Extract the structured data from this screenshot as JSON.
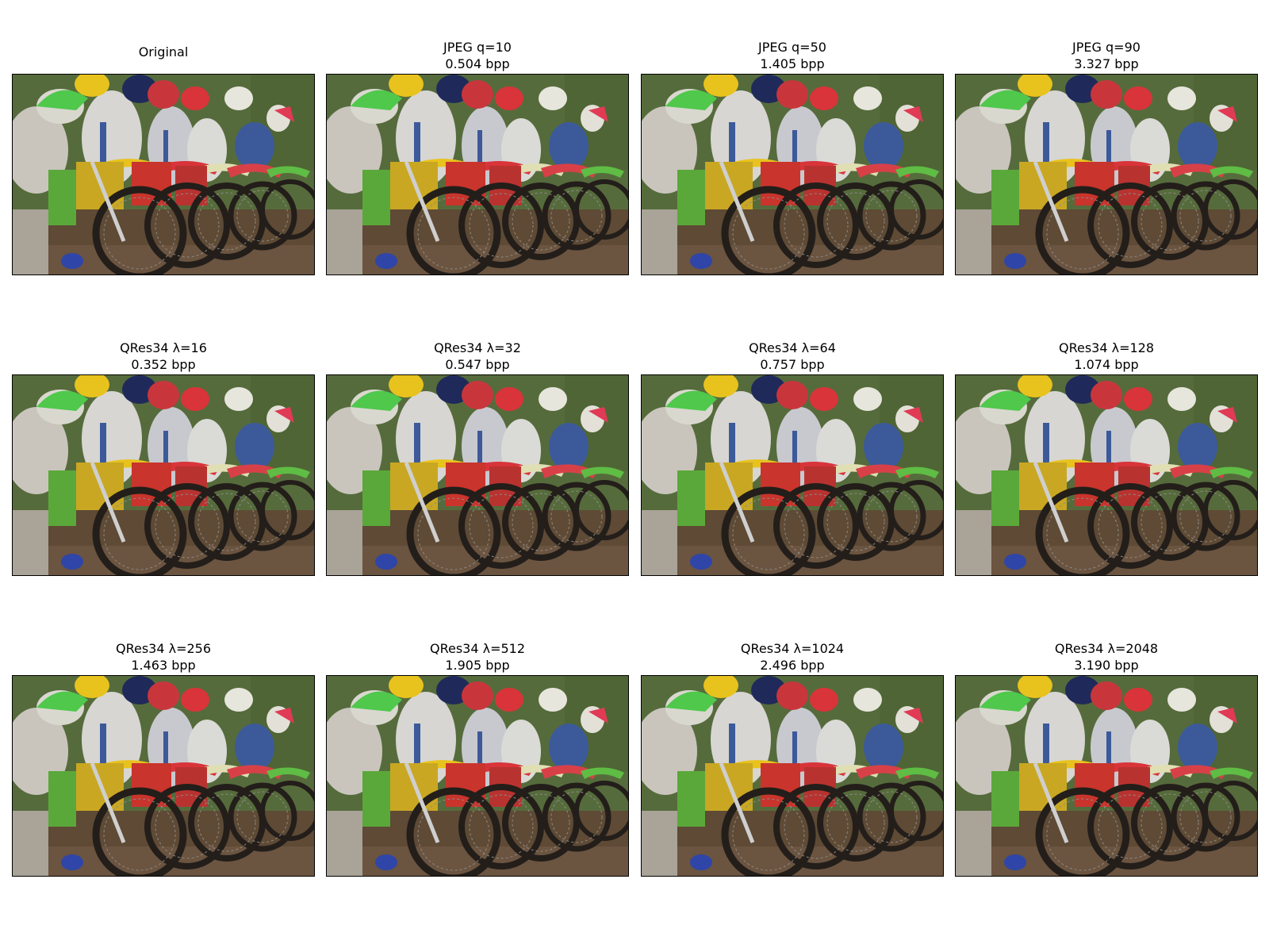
{
  "panels": [
    {
      "line1": "",
      "line2": "Original"
    },
    {
      "line1": "JPEG q=10",
      "line2": "0.504 bpp"
    },
    {
      "line1": "JPEG q=50",
      "line2": "1.405 bpp"
    },
    {
      "line1": "JPEG q=90",
      "line2": "3.327 bpp"
    },
    {
      "line1": "QRes34 λ=16",
      "line2": "0.352 bpp"
    },
    {
      "line1": "QRes34 λ=32",
      "line2": "0.547 bpp"
    },
    {
      "line1": "QRes34 λ=64",
      "line2": "0.757 bpp"
    },
    {
      "line1": "QRes34 λ=128",
      "line2": "1.074 bpp"
    },
    {
      "line1": "QRes34 λ=256",
      "line2": "1.463 bpp"
    },
    {
      "line1": "QRes34 λ=512",
      "line2": "1.905 bpp"
    },
    {
      "line1": "QRes34 λ=1024",
      "line2": "2.496 bpp"
    },
    {
      "line1": "QRes34 λ=2048",
      "line2": "3.190 bpp"
    }
  ],
  "colors": {
    "ground": "#5e4a35",
    "grass": "#566b3c",
    "yellow_fender": "#e8c21d",
    "red_fender": "#d8343a",
    "green_helmet": "#4fc84c",
    "tire": "#231e1a",
    "rider_white": "#d7d6d3",
    "rider_blue": "#3c5a9a"
  }
}
